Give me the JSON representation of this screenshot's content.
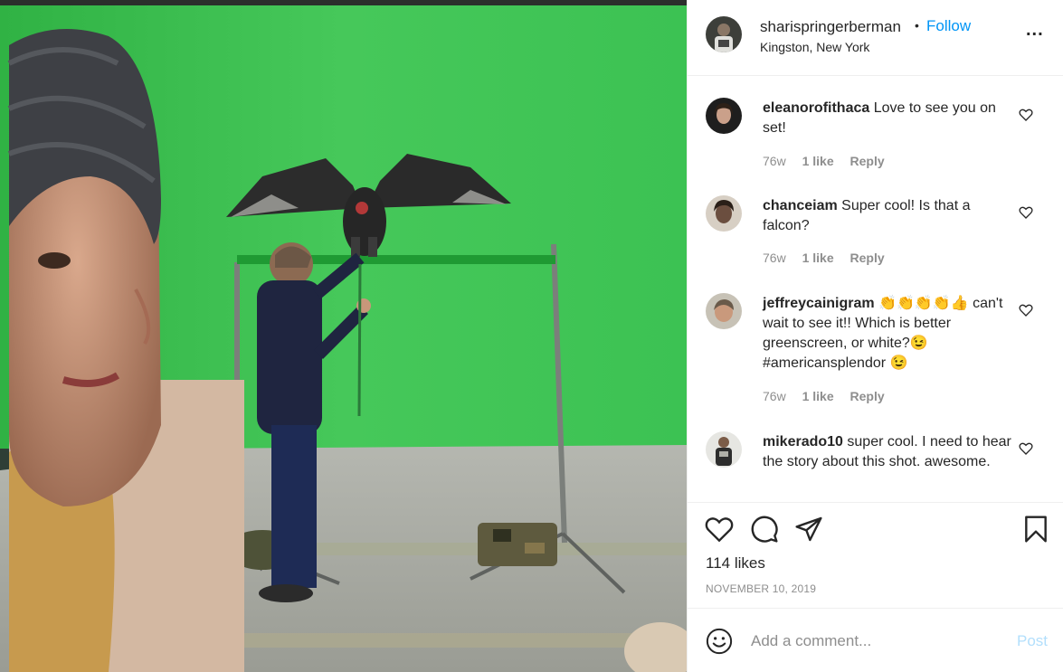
{
  "post": {
    "author": "sharispringerberman",
    "follow_label": "Follow",
    "separator": "•",
    "location": "Kingston, New York",
    "more_label": "..."
  },
  "comments": [
    {
      "username": "eleanorofithaca",
      "text": "Love to see you on set!",
      "time": "76w",
      "likes": "1 like",
      "reply": "Reply"
    },
    {
      "username": "chanceiam",
      "text": "Super cool! Is that a falcon?",
      "time": "76w",
      "likes": "1 like",
      "reply": "Reply"
    },
    {
      "username": "jeffreycainigram",
      "text": "👏👏👏👏👍 can't wait to see it!! Which is better greenscreen, or white?😉 #americansplendor 😉",
      "time": "76w",
      "likes": "1 like",
      "reply": "Reply"
    },
    {
      "username": "mikerado10",
      "text": "super cool. I need to hear the story about this shot. awesome."
    }
  ],
  "engagement": {
    "likes_label": "114 likes",
    "date": "NOVEMBER 10, 2019"
  },
  "add_comment": {
    "placeholder": "Add a comment...",
    "post_label": "Post"
  },
  "icons": {
    "like": "heart-icon",
    "comment": "comment-bubble-icon",
    "share": "paper-plane-icon",
    "save": "bookmark-icon",
    "emoji": "smiley-icon",
    "more": "ellipsis-icon"
  },
  "colors": {
    "link_blue": "#0095f6",
    "post_disabled": "#b2dffc",
    "muted": "#8e8e8e",
    "greenscreen": "#3ec24a"
  }
}
